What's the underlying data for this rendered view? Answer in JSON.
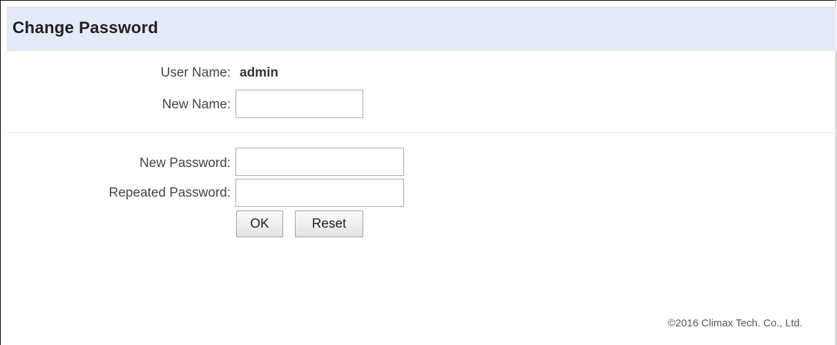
{
  "header": {
    "title": "Change Password"
  },
  "form": {
    "user_name_label": "User Name:",
    "user_name_value": "admin",
    "new_name_label": "New Name:",
    "new_name_value": "",
    "new_password_label": "New Password:",
    "new_password_value": "",
    "repeated_password_label": "Repeated Password:",
    "repeated_password_value": ""
  },
  "buttons": {
    "ok_label": "OK",
    "reset_label": "Reset"
  },
  "footer": {
    "copyright": "©2016 Climax Tech. Co., Ltd."
  }
}
